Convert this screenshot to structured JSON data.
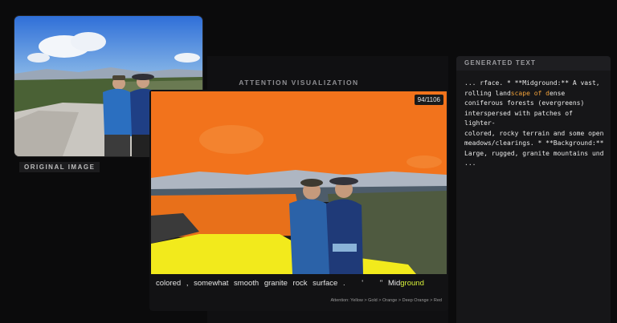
{
  "original_image": {
    "label": "ORIGINAL IMAGE",
    "description_icon": "photo-two-hikers"
  },
  "attention": {
    "title": "ATTENTION VISUALIZATION",
    "counter": "94/1106",
    "tokens": [
      "colored",
      ",",
      "somewhat",
      "smooth",
      "granite",
      "rock",
      "surface",
      ".",
      "'",
      "'' Mid"
    ],
    "highlight_token": "ground",
    "legend": "Attention: Yellow > Gold > Orange > Deep Orange > Red"
  },
  "generated_text": {
    "header": "GENERATED TEXT",
    "before": "... rface. * **Midground:** A vast,\nrolling land",
    "highlight": "scape of d",
    "after": "ense\nconiferous forests (evergreens)\ninterspersed with patches of lighter-\ncolored, rocky terrain and some open\nmeadows/clearings. * **Background:**\nLarge, rugged, granite mountains und\n..."
  },
  "colors": {
    "background": "#0b0b0c",
    "attention_orange": "#f2731c",
    "attention_yellow": "#f2ea1c",
    "highlight_text": "#f2a23a",
    "token_highlight": "#d8f23a"
  }
}
